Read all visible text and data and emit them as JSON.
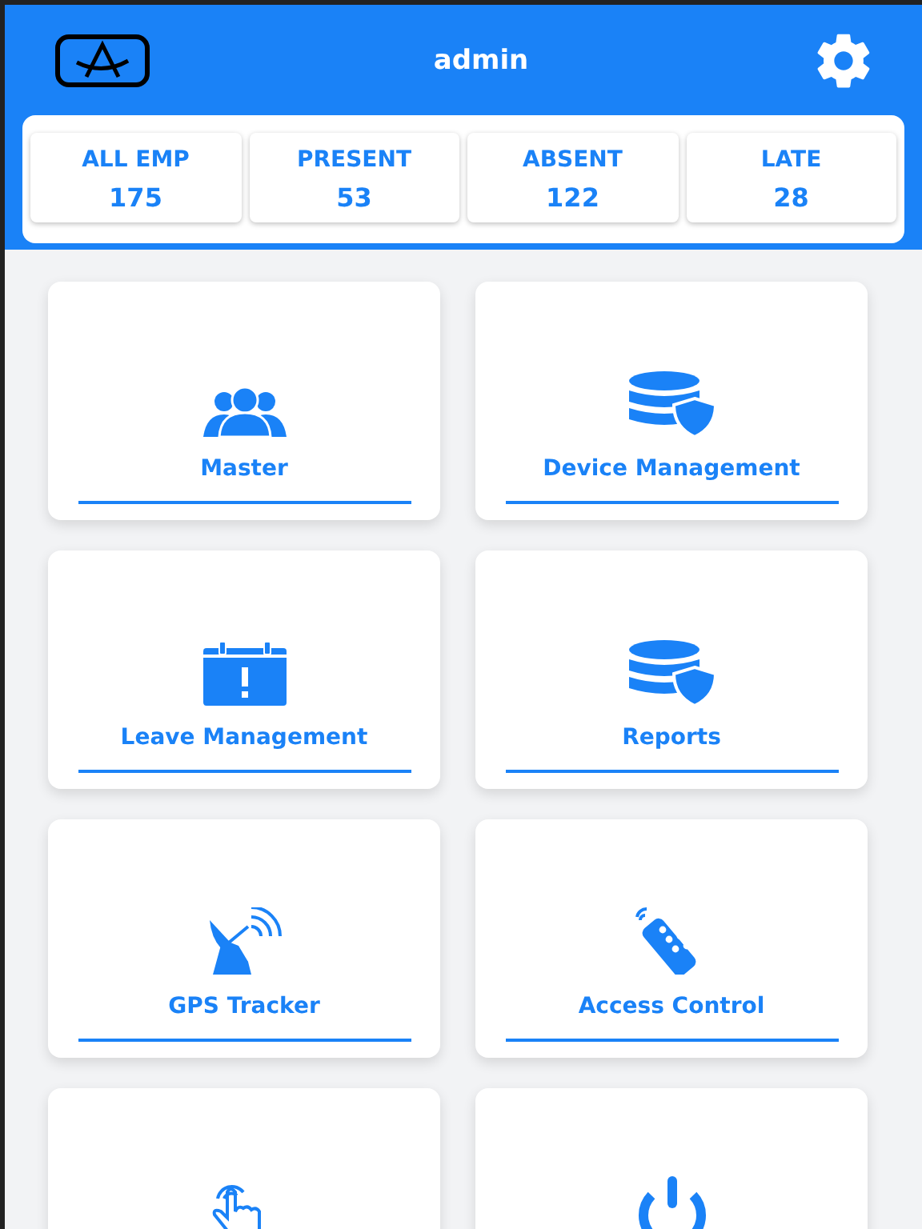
{
  "header": {
    "title": "admin"
  },
  "stats": [
    {
      "label": "ALL EMP",
      "value": "175"
    },
    {
      "label": "PRESENT",
      "value": "53"
    },
    {
      "label": "ABSENT",
      "value": "122"
    },
    {
      "label": "LATE",
      "value": "28"
    }
  ],
  "tiles": [
    {
      "kind": "people",
      "label": "Master"
    },
    {
      "kind": "database",
      "label": "Device Management"
    },
    {
      "kind": "calendar",
      "label": "Leave Management"
    },
    {
      "kind": "database",
      "label": "Reports"
    },
    {
      "kind": "satellite",
      "label": "GPS Tracker"
    },
    {
      "kind": "remote",
      "label": "Access Control"
    },
    {
      "kind": "hand"
    },
    {
      "kind": "power"
    }
  ]
}
